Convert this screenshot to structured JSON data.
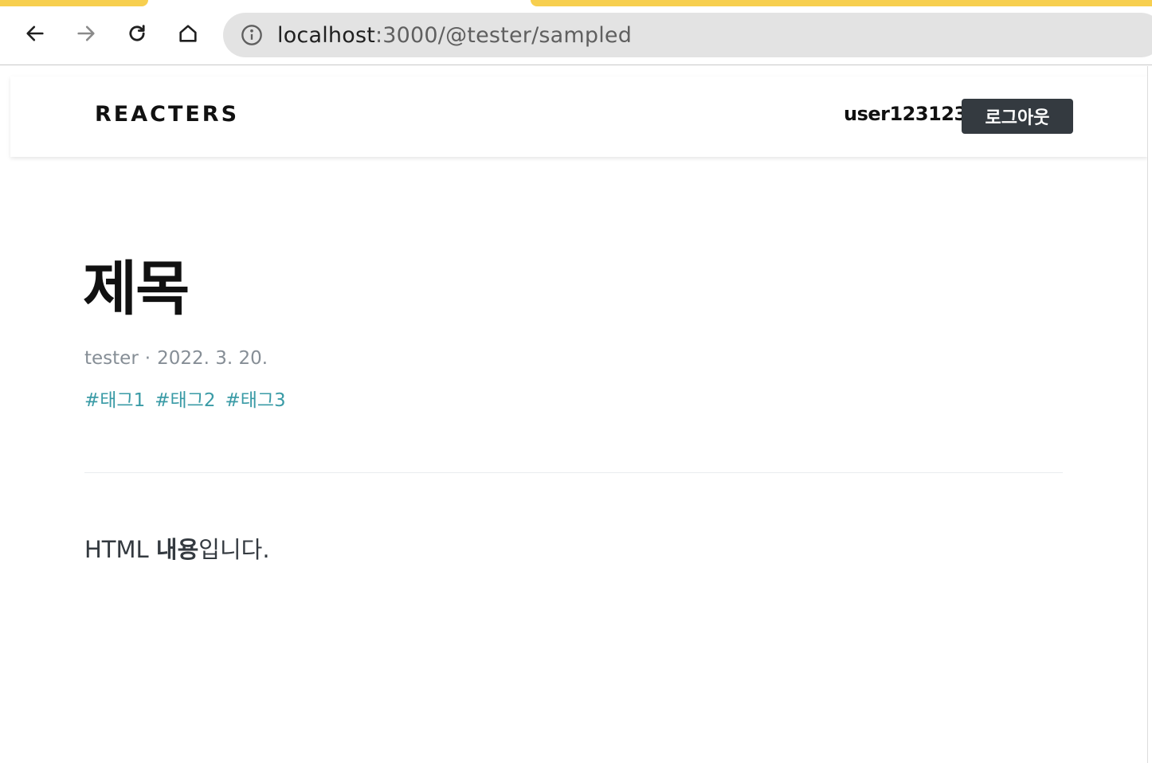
{
  "browser": {
    "url_host": "localhost",
    "url_rest": ":3000/@tester/sampled"
  },
  "header": {
    "logo": "REACTERS",
    "username": "user123123",
    "logout_label": "로그아웃"
  },
  "post": {
    "title": "제목",
    "author": "tester",
    "separator": "·",
    "date": "2022. 3. 20.",
    "tags": [
      "#태그1",
      "#태그2",
      "#태그3"
    ],
    "content_plain_start": "HTML ",
    "content_bold": "내용",
    "content_plain_end": "입니다."
  },
  "colors": {
    "tab_accent": "#f7cf4f",
    "logout_bg": "#343a40",
    "tag": "#3a9ba6",
    "meta": "#868e96"
  }
}
